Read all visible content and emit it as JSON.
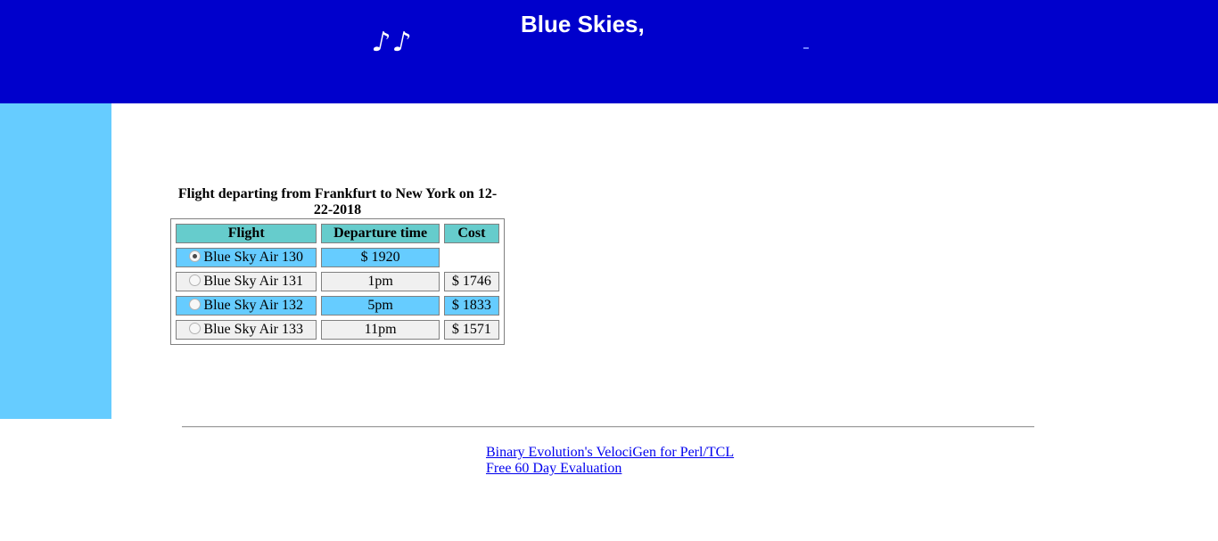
{
  "header": {
    "notes": "♪♪",
    "brand": "Blue Skies,"
  },
  "colors": {
    "header_bg": "#0000cc",
    "sidebar_bg": "#66ccff",
    "th_bg": "#66cccc",
    "highlight_bg": "#66ccff"
  },
  "caption": "Flight departing from Frankfurt to New York on 12-22-2018",
  "table": {
    "headers": [
      "Flight",
      "Departure time",
      "Cost"
    ],
    "rows": [
      {
        "flight": "Blue Sky Air 130",
        "departure": "$ 1920",
        "cost": "",
        "selected": true
      },
      {
        "flight": "Blue Sky Air 131",
        "departure": "1pm",
        "cost": "$ 1746",
        "selected": false
      },
      {
        "flight": "Blue Sky Air 132",
        "departure": "5pm",
        "cost": "$ 1833",
        "selected": false
      },
      {
        "flight": "Blue Sky Air 133",
        "departure": "11pm",
        "cost": "$ 1571",
        "selected": false
      }
    ]
  },
  "footer": {
    "link1": "Binary Evolution's VelociGen for Perl/TCL",
    "link2": "Free 60 Day Evaluation"
  }
}
